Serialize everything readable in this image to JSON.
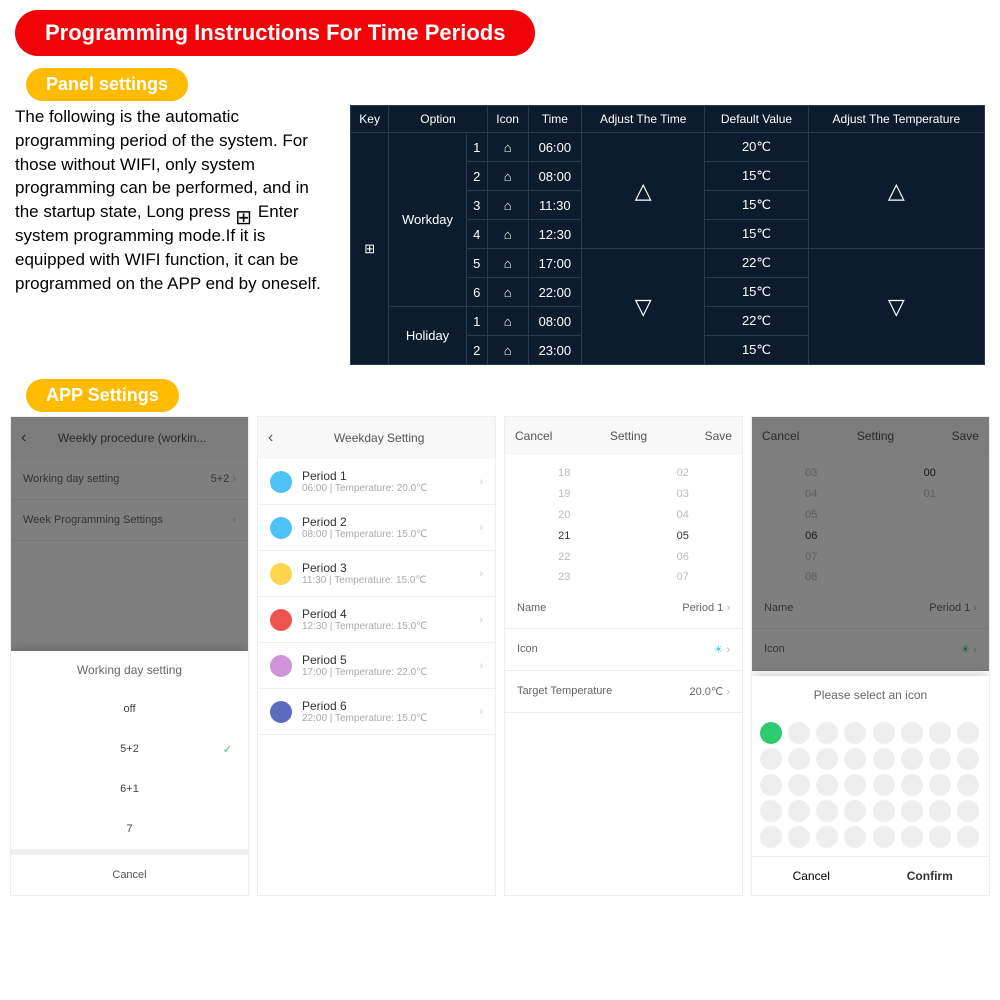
{
  "main_title": "Programming Instructions For Time Periods",
  "panel_settings_label": "Panel settings",
  "app_settings_label": "APP Settings",
  "description": {
    "text_before": "The following is the automatic programming period of the system. For those without WIFI, only system programming can be performed, and in the startup state, Long press ",
    "text_after": " Enter system programming mode.If it is equipped with WIFI function, it can be programmed on the APP end by oneself."
  },
  "table": {
    "headers": [
      "Key",
      "Option",
      "",
      "Icon",
      "Time",
      "Adjust The Time",
      "Default Value",
      "Adjust The Temperature"
    ],
    "option_workday": "Workday",
    "option_holiday": "Holiday",
    "workday_rows": [
      {
        "n": "1",
        "time": "06:00",
        "temp": "20℃"
      },
      {
        "n": "2",
        "time": "08:00",
        "temp": "15℃"
      },
      {
        "n": "3",
        "time": "11:30",
        "temp": "15℃"
      },
      {
        "n": "4",
        "time": "12:30",
        "temp": "15℃"
      },
      {
        "n": "5",
        "time": "17:00",
        "temp": "22℃"
      },
      {
        "n": "6",
        "time": "22:00",
        "temp": "15℃"
      }
    ],
    "holiday_rows": [
      {
        "n": "1",
        "time": "08:00",
        "temp": "22℃"
      },
      {
        "n": "2",
        "time": "23:00",
        "temp": "15℃"
      }
    ]
  },
  "screen1": {
    "title": "Weekly procedure (workin...",
    "row1_label": "Working day setting",
    "row1_value": "5+2",
    "row2_label": "Week Programming Settings",
    "sheet_title": "Working day setting",
    "options": [
      "off",
      "5+2",
      "6+1",
      "7"
    ],
    "active_index": 1,
    "cancel": "Cancel"
  },
  "screen2": {
    "title": "Weekday Setting",
    "periods": [
      {
        "title": "Period 1",
        "subtitle": "06:00  |  Temperature: 20.0℃",
        "color": "#4fc3f7"
      },
      {
        "title": "Period 2",
        "subtitle": "08:00  |  Temperature: 15.0℃",
        "color": "#4fc3f7"
      },
      {
        "title": "Period 3",
        "subtitle": "11:30  |  Temperature: 15.0℃",
        "color": "#ffd54f"
      },
      {
        "title": "Period 4",
        "subtitle": "12:30  |  Temperature: 15.0℃",
        "color": "#ef5350"
      },
      {
        "title": "Period 5",
        "subtitle": "17:00  |  Temperature: 22.0℃",
        "color": "#ce93d8"
      },
      {
        "title": "Period 6",
        "subtitle": "22:00  |  Temperature: 15.0℃",
        "color": "#5c6bc0"
      }
    ]
  },
  "screen3": {
    "cancel": "Cancel",
    "title": "Setting",
    "save": "Save",
    "picker_left": [
      "18",
      "19",
      "20",
      "21",
      "22",
      "23"
    ],
    "picker_right": [
      "02",
      "03",
      "04",
      "05",
      "06",
      "07"
    ],
    "selected_index": 3,
    "row_name_label": "Name",
    "row_name_value": "Period 1",
    "row_icon_label": "Icon",
    "row_temp_label": "Target Temperature",
    "row_temp_value": "20.0℃"
  },
  "screen4": {
    "cancel": "Cancel",
    "title": "Setting",
    "save": "Save",
    "picker_left": [
      "03",
      "04",
      "05",
      "06",
      "07",
      "08"
    ],
    "picker_right": [
      "",
      "",
      "00",
      "01",
      "",
      ""
    ],
    "row_name_label": "Name",
    "row_name_value": "Period 1",
    "row_icon_label": "Icon",
    "sheet_title": "Please select an icon",
    "sheet_cancel": "Cancel",
    "sheet_confirm": "Confirm",
    "icon_count": 40
  }
}
